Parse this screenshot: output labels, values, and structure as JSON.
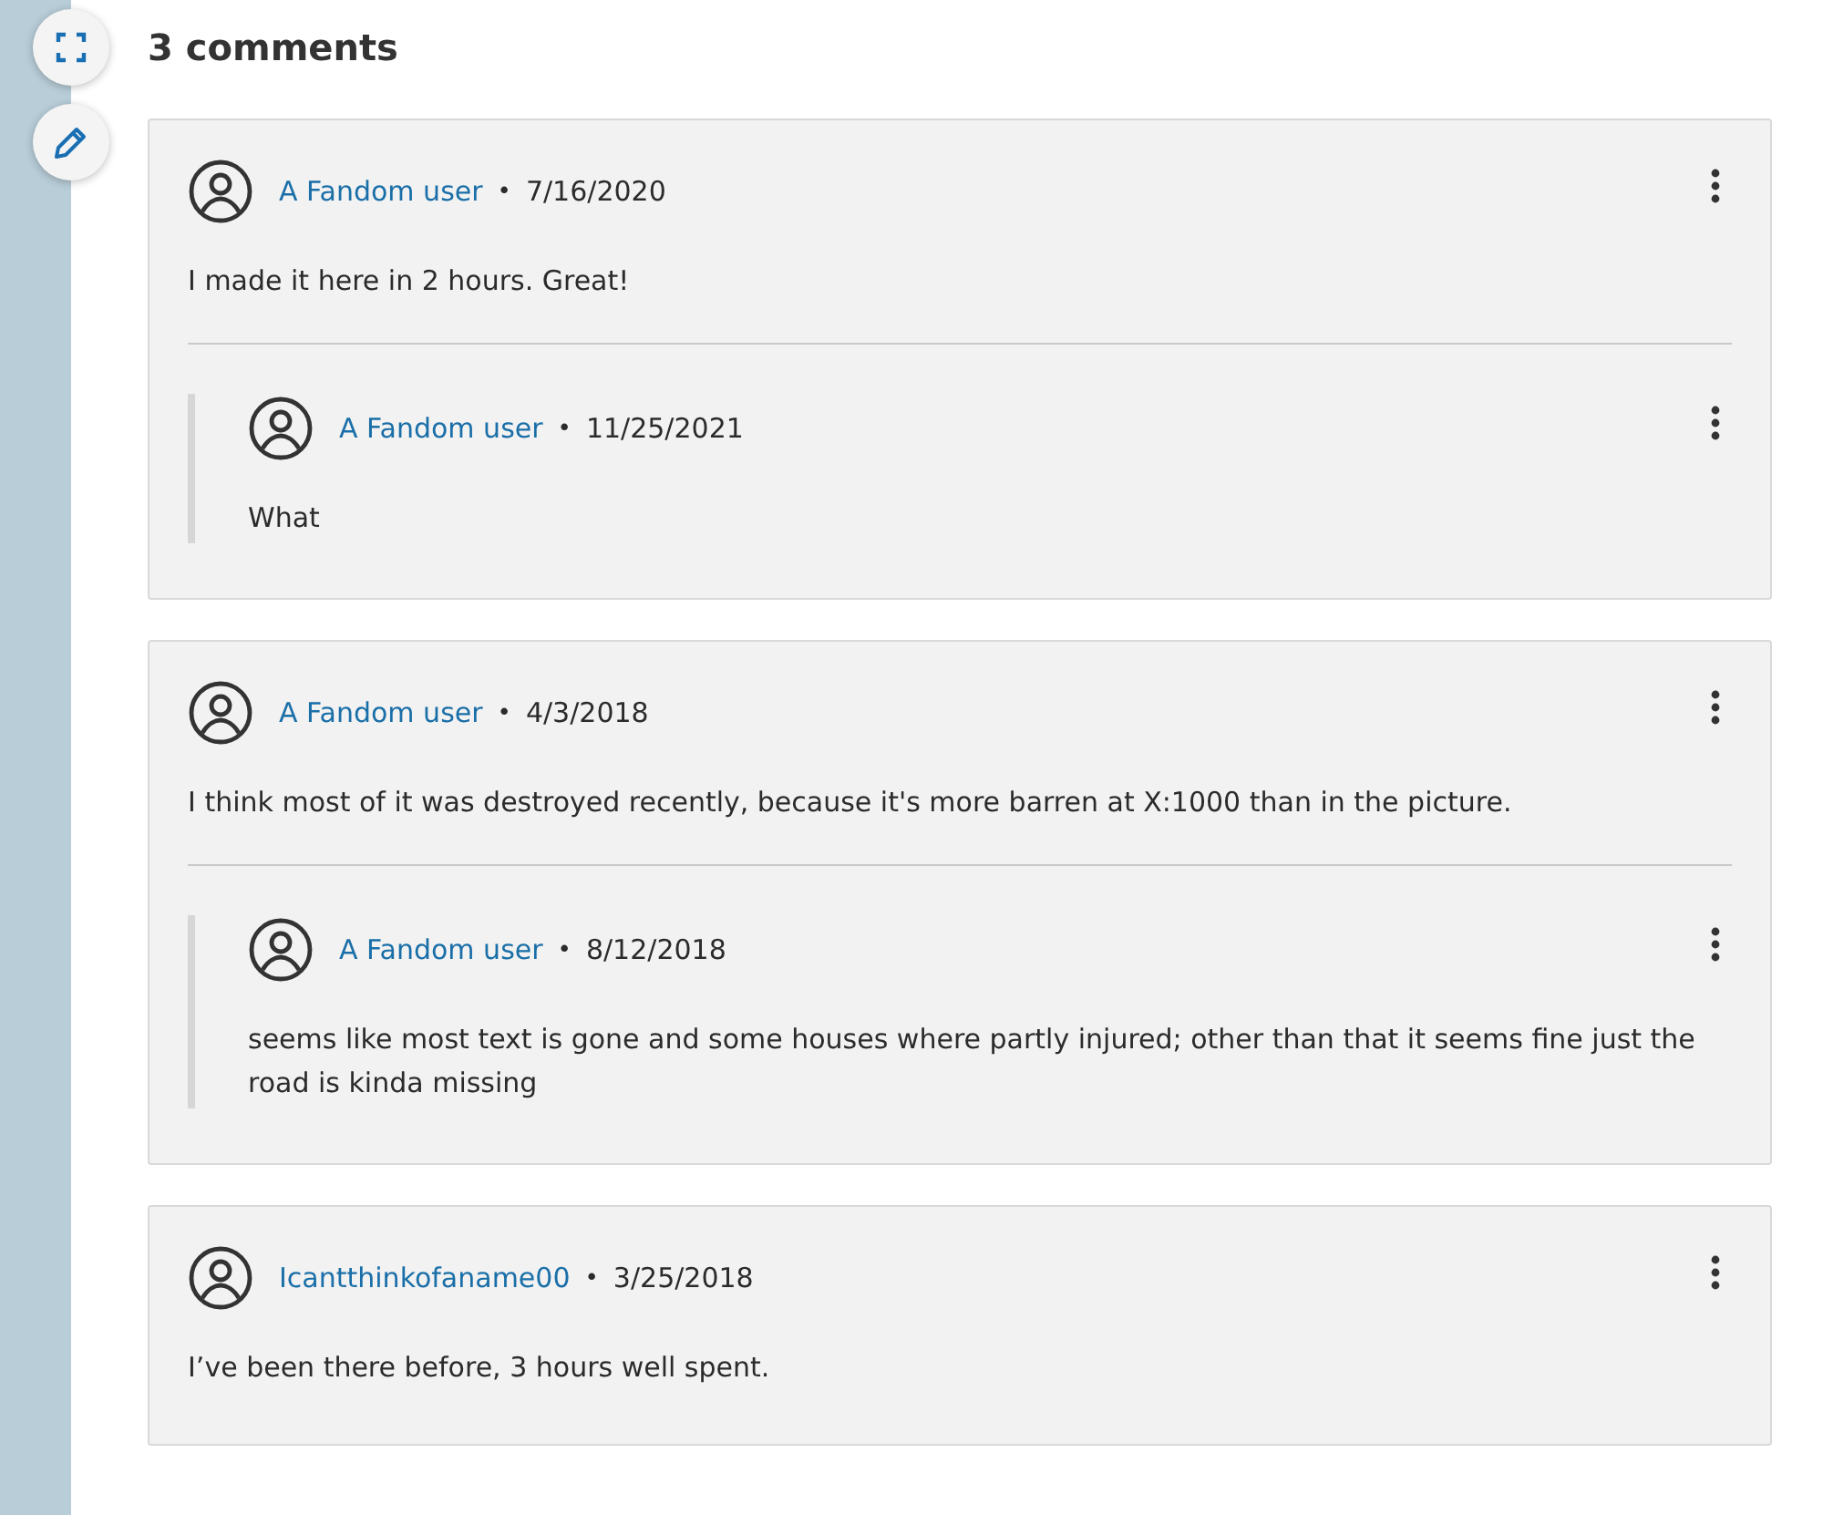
{
  "heading": "3 comments",
  "side_buttons": [
    {
      "kind": "expand"
    },
    {
      "kind": "edit"
    }
  ],
  "comments": [
    {
      "author": "A Fandom user",
      "separator": "•",
      "date": "7/16/2020",
      "text": "I made it here in 2 hours. Great!",
      "replies": [
        {
          "author": "A Fandom user",
          "separator": "•",
          "date": "11/25/2021",
          "text": "What"
        }
      ]
    },
    {
      "author": "A Fandom user",
      "separator": "•",
      "date": "4/3/2018",
      "text": "I think most of it was destroyed recently, because it's more barren at X:1000 than in the picture.",
      "replies": [
        {
          "author": "A Fandom user",
          "separator": "•",
          "date": "8/12/2018",
          "text": "seems like most text is gone and some houses where partly injured; other than that it seems fine just the road is kinda missing"
        }
      ]
    },
    {
      "author": "Icantthinkofaname00",
      "separator": "•",
      "date": "3/25/2018",
      "text": "I’ve been there before, 3 hours well spent."
    }
  ]
}
